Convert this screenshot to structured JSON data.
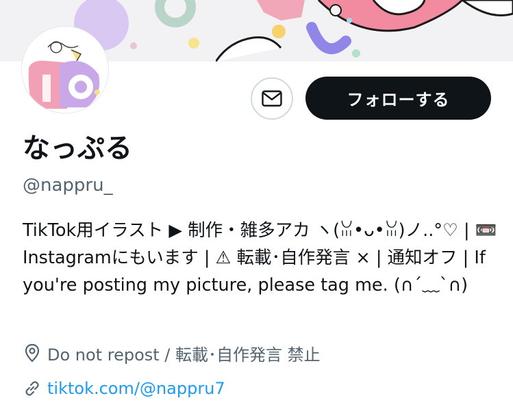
{
  "profile": {
    "display_name": "なっぷる",
    "handle": "@nappru_",
    "bio": "TikTok用イラスト ▶ 制作・雑多アカ ヽ(ꈍ•ᴗ•ꈍ)ノ..°♡ | 📼 Instagramにもいます | ⚠ 転載･自作発言 × | 通知オフ | If you're posting my picture, please tag me. (∩´﹏`∩)",
    "location": "Do not repost / 転載･自作発言 禁止",
    "website": "tiktok.com/@nappru7"
  },
  "actions": {
    "follow_label": "フォローする",
    "message_icon": "envelope-icon"
  },
  "icons": {
    "location": "map-pin-icon",
    "link": "link-icon"
  },
  "colors": {
    "follow_bg": "#0f1419",
    "link": "#1d9bf0",
    "secondary_text": "#536471"
  }
}
